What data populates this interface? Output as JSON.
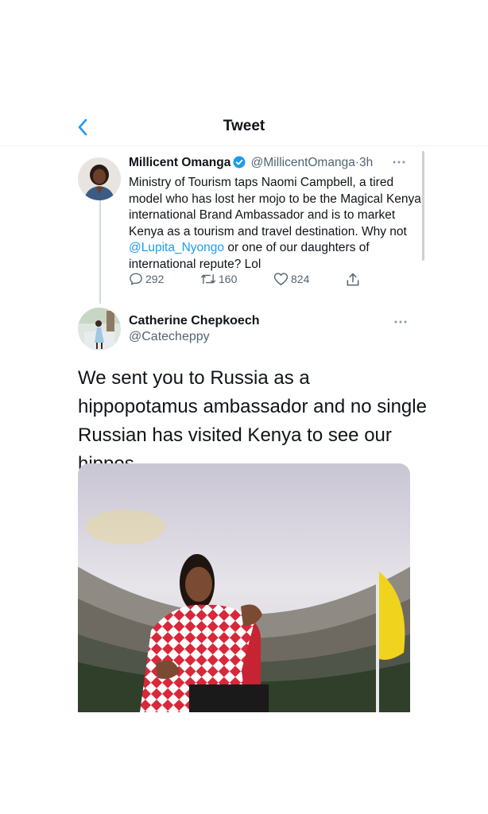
{
  "header": {
    "title": "Tweet"
  },
  "quoted_tweet": {
    "author_name": "Millicent Omanga",
    "author_handle": "@MillicentOmanga",
    "separator": "·",
    "time": "3h",
    "text_before": "Ministry of Tourism taps Naomi Campbell, a tired model who has lost her mojo to be the Magical Kenya international Brand Ambassador and is to market Kenya as a tourism and travel destination. Why not ",
    "mention": "@Lupita_Nyongo",
    "text_after": " or one of our daughters of international repute? Lol",
    "replies": "292",
    "retweets": "160",
    "likes": "824"
  },
  "main_tweet": {
    "author_name": "Catherine Chepkoech",
    "author_handle": "@Catecheppy",
    "text": "We sent you to Russia as a hippopotamus ambassador and no single Russian has visited Kenya to see our hippos."
  },
  "colors": {
    "accent": "#1d9bf0",
    "text": "#0f1419",
    "secondary": "#536471",
    "divider": "#eff3f4"
  },
  "icons": {
    "back": "chevron-left-icon",
    "verified": "verified-badge-icon",
    "more": "more-horizontal-icon",
    "reply": "reply-icon",
    "retweet": "retweet-icon",
    "like": "heart-icon",
    "share": "share-icon"
  }
}
